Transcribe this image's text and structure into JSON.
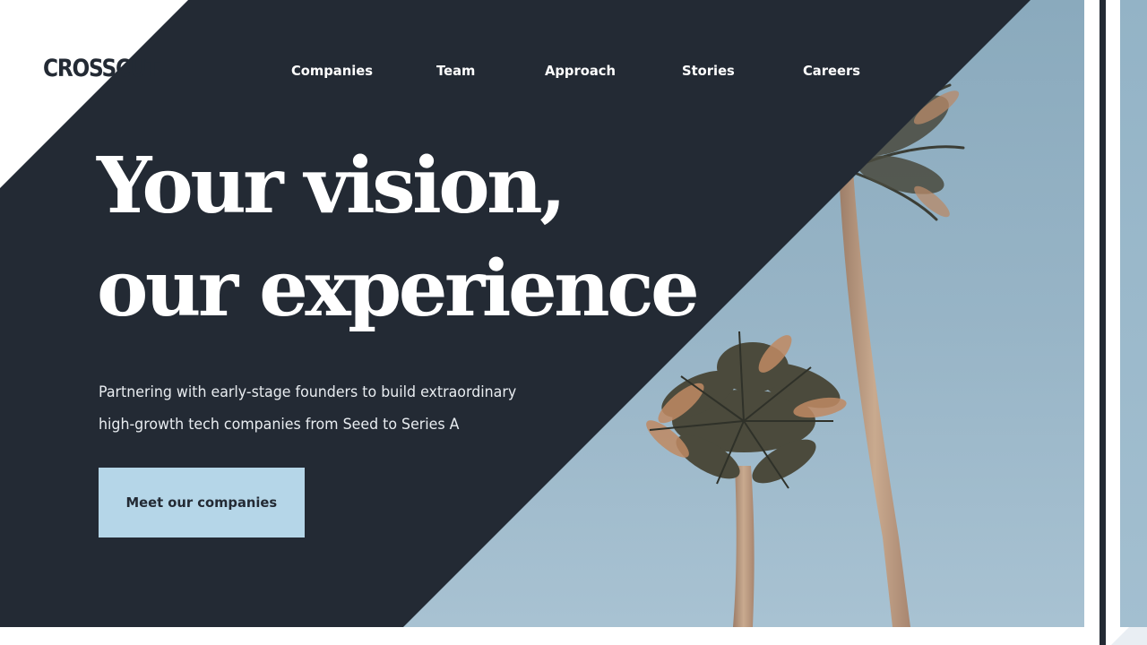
{
  "brand": {
    "logo_text": "CROSSCUT"
  },
  "nav": {
    "items": [
      {
        "label": "Companies"
      },
      {
        "label": "Team"
      },
      {
        "label": "Approach"
      },
      {
        "label": "Stories"
      },
      {
        "label": "Careers"
      }
    ]
  },
  "hero": {
    "headline_line1": "Your vision,",
    "headline_line2": "our experience",
    "subheading_line1": "Partnering with early-stage founders to build extraordinary",
    "subheading_line2": "high-growth tech companies from Seed to Series A",
    "cta_label": "Meet our companies",
    "image_subject": "palm-trees-against-sky"
  },
  "colors": {
    "navy": "#232a34",
    "sky": "#a3bfd0",
    "cta_background": "#b5d6e8",
    "text_on_dark": "#ffffff"
  }
}
